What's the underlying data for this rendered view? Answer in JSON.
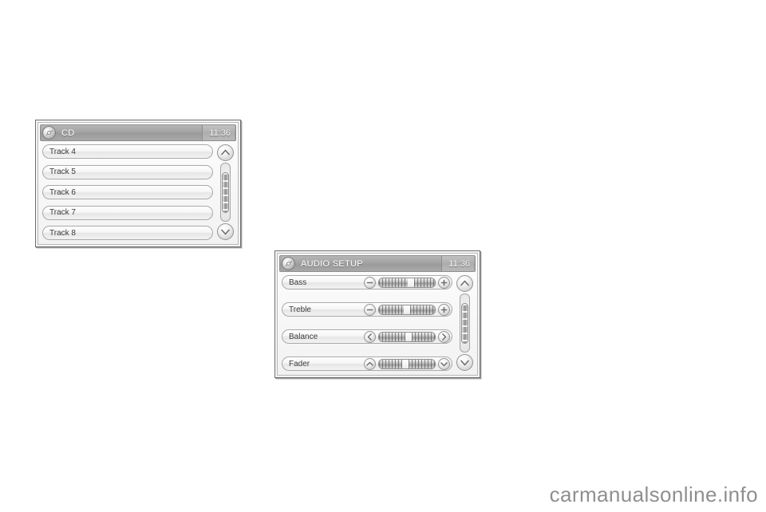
{
  "page": {
    "background_color": "#ffffff",
    "watermark": "carmanualsonline.info"
  },
  "figures": [
    {
      "id": "cd-screen",
      "screen": {
        "titlebar": {
          "icon": "cd-disc-icon",
          "title": "CD",
          "time": "11:36"
        },
        "rows": [
          {
            "label": "Track 4"
          },
          {
            "label": "Track 5"
          },
          {
            "label": "Track 6"
          },
          {
            "label": "Track 7"
          },
          {
            "label": "Track 8"
          }
        ],
        "scrollbar": {
          "up_icon": "chevron-up-icon",
          "down_icon": "chevron-down-icon",
          "thumb_top_percent": 14,
          "thumb_height_percent": 72
        }
      }
    },
    {
      "id": "audio-setup-screen",
      "screen": {
        "titlebar": {
          "icon": "audio-disc-icon",
          "title": "AUDIO SETUP",
          "time": "11:36"
        },
        "rows": [
          {
            "label": "Bass",
            "left_icon": "minus-icon",
            "right_icon": "plus-icon",
            "slider_position_percent": 57
          },
          {
            "label": "Treble",
            "left_icon": "minus-icon",
            "right_icon": "plus-icon",
            "slider_position_percent": 50
          },
          {
            "label": "Balance",
            "left_icon": "chevron-left-icon",
            "right_icon": "chevron-right-icon",
            "slider_position_percent": 53
          },
          {
            "label": "Fader",
            "left_icon": "chevron-up-icon",
            "right_icon": "chevron-down-icon",
            "slider_position_percent": 47
          }
        ],
        "scrollbar": {
          "up_icon": "chevron-up-icon",
          "down_icon": "chevron-down-icon",
          "thumb_top_percent": 14,
          "thumb_height_percent": 72
        }
      }
    }
  ],
  "colors": {
    "titlebar": "#a2a2a2",
    "titlebar_text": "#ffffff",
    "row_text": "#3a3a3a",
    "bezel": "#6f6f6f",
    "watermark": "#8f8f8f"
  }
}
